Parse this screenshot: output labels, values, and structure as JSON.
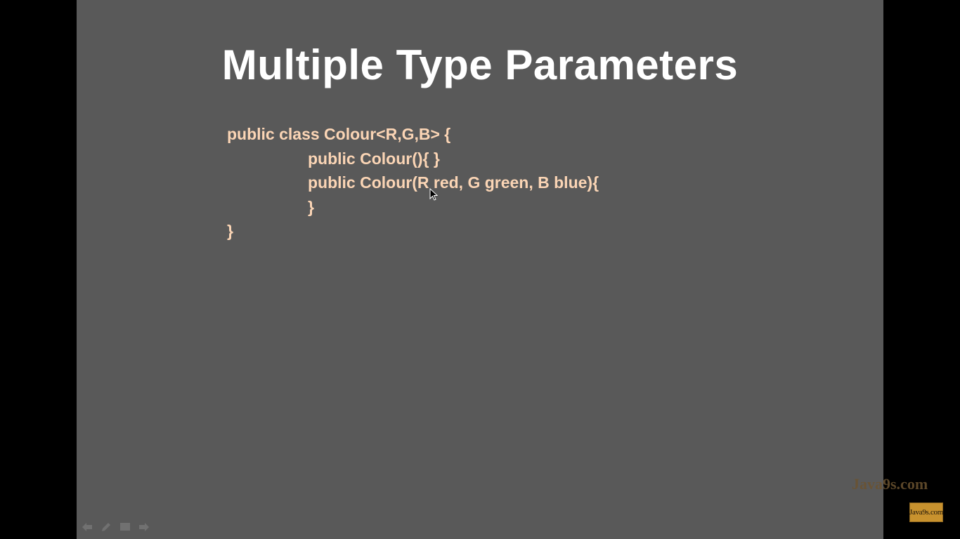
{
  "slide": {
    "title": "Multiple Type Parameters",
    "code_lines": [
      "public class Colour<R,G,B> {",
      "public Colour(){ }",
      "public Colour(R red, G green, B blue){",
      "}",
      "}"
    ]
  },
  "nav_controls": [
    {
      "name": "previous-slide",
      "icon": "arrow-left-icon"
    },
    {
      "name": "pen-tool",
      "icon": "pen-icon"
    },
    {
      "name": "slide-menu",
      "icon": "menu-icon"
    },
    {
      "name": "next-slide",
      "icon": "arrow-right-icon"
    }
  ],
  "watermark": {
    "text": "Java9s.com",
    "logo_text": "Java9s.com"
  },
  "colors": {
    "slide_background": "#595959",
    "title": "#ffffff",
    "code": "#fbd5b5",
    "letterbox": "#000000"
  }
}
